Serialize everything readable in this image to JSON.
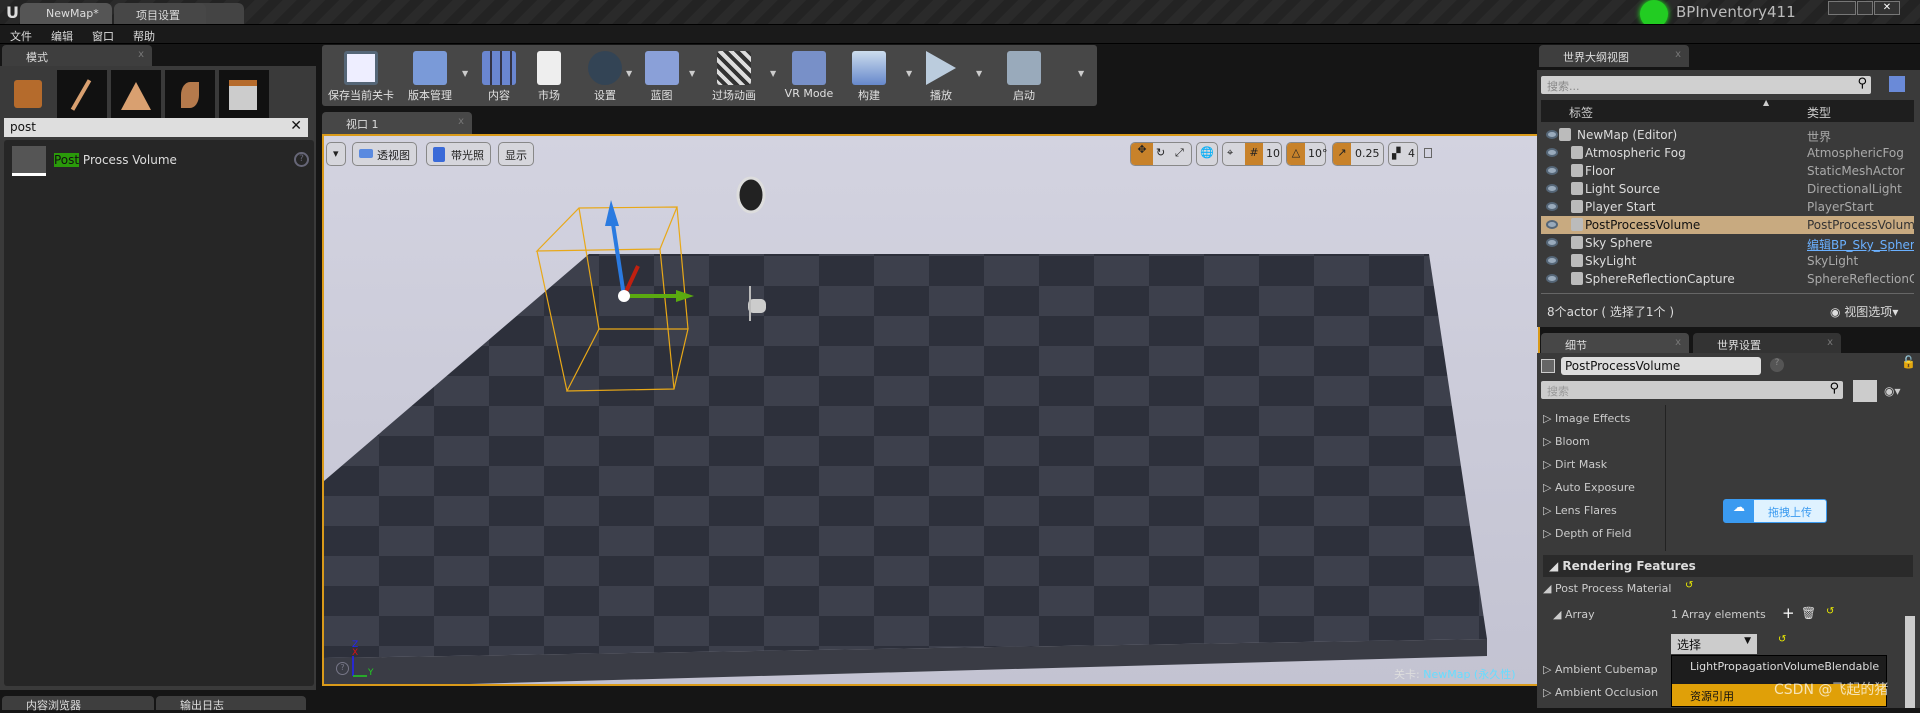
{
  "title_bar": {
    "tabs": [
      {
        "label": "NewMap*"
      },
      {
        "label": "项目设置"
      }
    ],
    "project": "BPInventory411"
  },
  "menu": [
    "文件",
    "编辑",
    "窗口",
    "帮助"
  ],
  "modes_panel": {
    "tab": "模式",
    "search_value": "post",
    "results": [
      {
        "label_highlight": "Post",
        "label_rest": " Process Volume"
      }
    ]
  },
  "toolbar": {
    "buttons": [
      {
        "label": "保存当前关卡",
        "icon": "save-icon"
      },
      {
        "label": "版本管理",
        "icon": "source-control-icon"
      },
      {
        "label": "内容",
        "icon": "content-icon"
      },
      {
        "label": "市场",
        "icon": "marketplace-icon"
      },
      {
        "label": "设置",
        "icon": "settings-icon"
      },
      {
        "label": "蓝图",
        "icon": "blueprint-icon"
      },
      {
        "label": "过场动画",
        "icon": "cinematics-icon"
      },
      {
        "label": "VR Mode",
        "icon": "vr-icon"
      },
      {
        "label": "构建",
        "icon": "build-icon"
      },
      {
        "label": "播放",
        "icon": "play-icon"
      },
      {
        "label": "启动",
        "icon": "launch-icon"
      }
    ]
  },
  "viewport": {
    "tab": "视口 1",
    "perspective": "透视图",
    "lit": "带光照",
    "show": "显示",
    "grid_snap": "10",
    "rot_snap": "10°",
    "scale_snap": "0.25",
    "cam_speed": "4",
    "level_label": "关卡:",
    "level_name": "NewMap (永久性)",
    "axis": {
      "x": "X",
      "y": "Y",
      "z": "Z"
    }
  },
  "bottom_tabs": [
    "内容浏览器",
    "输出日志"
  ],
  "outliner": {
    "tab": "世界大纲视图",
    "search_placeholder": "搜索...",
    "col_label": "标签",
    "col_type": "类型",
    "rows": [
      {
        "name": "NewMap (Editor)",
        "type": "世界"
      },
      {
        "name": "Atmospheric Fog",
        "type": "AtmosphericFog"
      },
      {
        "name": "Floor",
        "type": "StaticMeshActor"
      },
      {
        "name": "Light Source",
        "type": "DirectionalLight"
      },
      {
        "name": "Player Start",
        "type": "PlayerStart"
      },
      {
        "name": "PostProcessVolume",
        "type": "PostProcessVolume",
        "selected": true
      },
      {
        "name": "Sky Sphere",
        "type": "编辑BP_Sky_Sphere",
        "link": true
      },
      {
        "name": "SkyLight",
        "type": "SkyLight"
      },
      {
        "name": "SphereReflectionCapture",
        "type": "SphereReflectionCapture"
      }
    ],
    "footer": "8个actor ( 选择了1个 )",
    "view_options": "视图选项"
  },
  "details": {
    "tabs": [
      "细节",
      "世界设置"
    ],
    "name_value": "PostProcessVolume",
    "search_placeholder": "搜索",
    "categories": [
      "Image Effects",
      "Bloom",
      "Dirt Mask",
      "Auto Exposure",
      "Lens Flares",
      "Depth of Field"
    ],
    "upload_button": "拖拽上传",
    "rendering_features": "Rendering Features",
    "ppm": "Post Process Material",
    "array": "Array",
    "array_count": "1 Array elements",
    "select_value": "选择",
    "dropdown_items": [
      "LightPropagationVolumeBlendable",
      "资源引用"
    ],
    "more_categories": [
      "Ambient Cubemap",
      "Ambient Occlusion"
    ]
  },
  "watermark": "CSDN @飞起的猪",
  "colors": {
    "accent": "#d99a1a",
    "selected_row": "#c8aa80",
    "highlight": "#2a9a0a"
  }
}
